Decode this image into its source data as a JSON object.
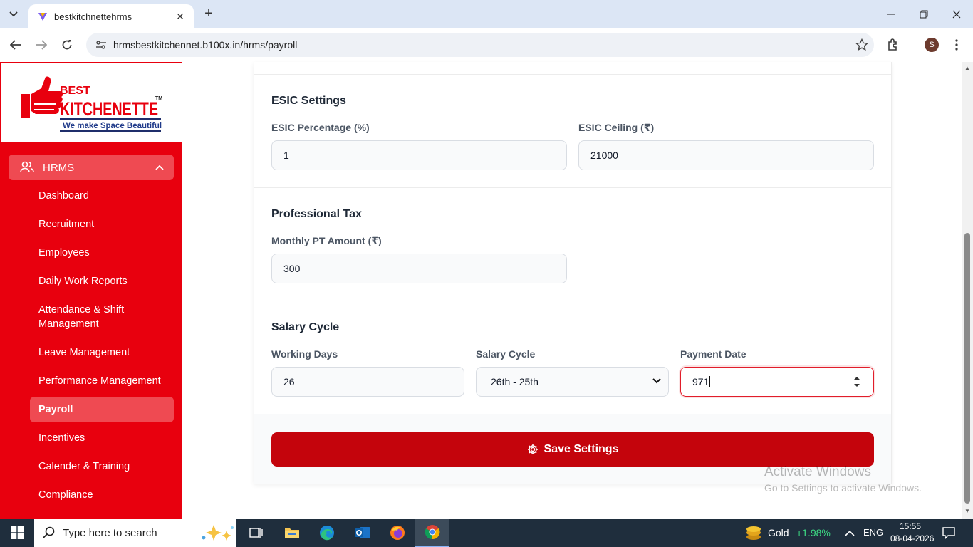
{
  "browser": {
    "tab_title": "bestkitchnettehrms",
    "url": "hrmsbestkitchennet.b100x.in/hrms/payroll",
    "profile_initial": "S"
  },
  "sidebar": {
    "logo": {
      "top_text": "BEST",
      "brand_text": "KITCHENETTE",
      "tm": "TM",
      "tagline": "We make Space Beautiful"
    },
    "module_label": "HRMS",
    "items": [
      {
        "label": "Dashboard"
      },
      {
        "label": "Recruitment"
      },
      {
        "label": "Employees"
      },
      {
        "label": "Daily Work Reports"
      },
      {
        "label": "Attendance & Shift Management"
      },
      {
        "label": "Leave Management"
      },
      {
        "label": "Performance Management"
      },
      {
        "label": "Payroll",
        "active": true
      },
      {
        "label": "Incentives"
      },
      {
        "label": "Calender & Training"
      },
      {
        "label": "Compliance"
      }
    ]
  },
  "esic": {
    "title": "ESIC Settings",
    "percentage_label": "ESIC Percentage (%)",
    "percentage_value": "1",
    "ceiling_label": "ESIC Ceiling (₹)",
    "ceiling_value": "21000"
  },
  "professional_tax": {
    "title": "Professional Tax",
    "amount_label": "Monthly PT Amount (₹)",
    "amount_value": "300"
  },
  "salary_cycle": {
    "title": "Salary Cycle",
    "working_days_label": "Working Days",
    "working_days_value": "26",
    "cycle_label": "Salary Cycle",
    "cycle_value": "26th - 25th",
    "payment_date_label": "Payment Date",
    "payment_date_value": "971"
  },
  "actions": {
    "save_label": "Save Settings"
  },
  "watermark": {
    "title": "Activate Windows",
    "subtitle": "Go to Settings to activate Windows."
  },
  "taskbar": {
    "search_placeholder": "Type here to search",
    "ticker_label": "Gold",
    "ticker_change": "+1.98%",
    "language": "ENG",
    "time": "15:55",
    "date": "08-04-2026"
  },
  "colors": {
    "brand_red": "#e8000e",
    "save_button": "#c4040c",
    "ticker_positive": "#3ddc84"
  }
}
